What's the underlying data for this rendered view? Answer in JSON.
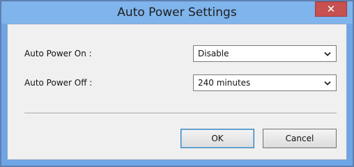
{
  "window": {
    "title": "Auto Power Settings",
    "close_glyph": "✕",
    "close_icon": "close-icon"
  },
  "settings": {
    "auto_power_on": {
      "label": "Auto Power On :",
      "value": "Disable"
    },
    "auto_power_off": {
      "label": "Auto Power Off :",
      "value": "240 minutes"
    }
  },
  "buttons": {
    "ok_label": "OK",
    "cancel_label": "Cancel"
  },
  "colors": {
    "title_bar": "#7fb4ec",
    "close_button": "#c75050",
    "client_background": "#f0f0f0"
  }
}
